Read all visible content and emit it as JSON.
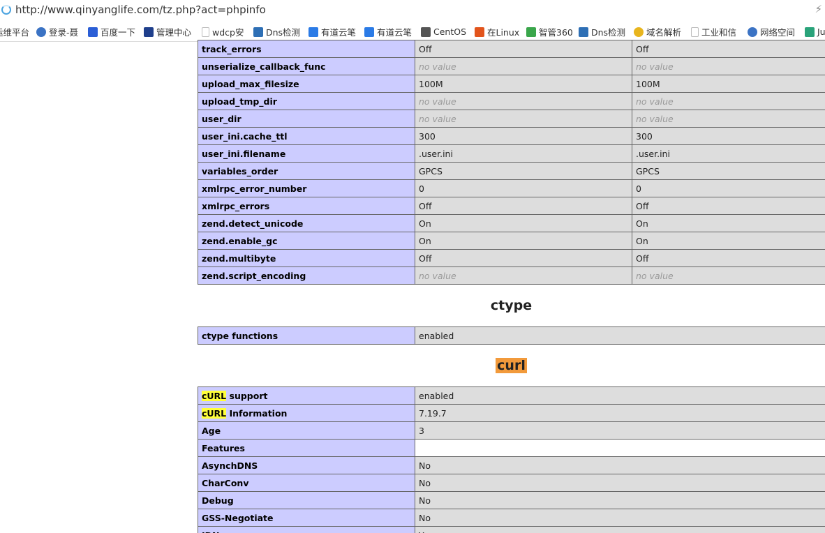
{
  "address_bar": {
    "url": "http://www.qinyanglife.com/tz.php?act=phpinfo"
  },
  "bookmarks": [
    {
      "label": "运维平台",
      "icon": "none",
      "color": "#ffffff"
    },
    {
      "label": "登录-聂",
      "icon": "globe-icon",
      "color": "#3b73c4"
    },
    {
      "label": "百度一下",
      "icon": "paw-icon",
      "color": "#2b5ed6"
    },
    {
      "label": "管理中心",
      "icon": "idc-icon",
      "color": "#1f3f8c"
    },
    {
      "label": "wdcp安",
      "icon": "page-icon",
      "color": "#bbbbbb"
    },
    {
      "label": "Dns检测",
      "icon": "chart-icon",
      "color": "#2e6fb5"
    },
    {
      "label": "有道云笔",
      "icon": "note-icon",
      "color": "#2b7be6"
    },
    {
      "label": "有道云笔",
      "icon": "note-icon",
      "color": "#2b7be6"
    },
    {
      "label": "CentOS",
      "icon": "centos-icon",
      "color": "#555555"
    },
    {
      "label": "在Linux",
      "icon": "bracket-icon",
      "color": "#e2541c"
    },
    {
      "label": "智管360",
      "icon": "g-icon",
      "color": "#3aa64b"
    },
    {
      "label": "Dns检测",
      "icon": "chart-icon",
      "color": "#2e6fb5"
    },
    {
      "label": "域名解析",
      "icon": "ball-icon",
      "color": "#e8b51e"
    },
    {
      "label": "工业和信",
      "icon": "page-icon",
      "color": "#bbbbbb"
    },
    {
      "label": "网络空间",
      "icon": "globe-icon",
      "color": "#3b73c4"
    },
    {
      "label": "Ju",
      "icon": "stack-icon",
      "color": "#2aa37a"
    }
  ],
  "config_rows": [
    {
      "name": "track_errors",
      "local": "Off",
      "master": "Off",
      "nv": false
    },
    {
      "name": "unserialize_callback_func",
      "local": "no value",
      "master": "no value",
      "nv": true
    },
    {
      "name": "upload_max_filesize",
      "local": "100M",
      "master": "100M",
      "nv": false
    },
    {
      "name": "upload_tmp_dir",
      "local": "no value",
      "master": "no value",
      "nv": true
    },
    {
      "name": "user_dir",
      "local": "no value",
      "master": "no value",
      "nv": true
    },
    {
      "name": "user_ini.cache_ttl",
      "local": "300",
      "master": "300",
      "nv": false
    },
    {
      "name": "user_ini.filename",
      "local": ".user.ini",
      "master": ".user.ini",
      "nv": false
    },
    {
      "name": "variables_order",
      "local": "GPCS",
      "master": "GPCS",
      "nv": false
    },
    {
      "name": "xmlrpc_error_number",
      "local": "0",
      "master": "0",
      "nv": false
    },
    {
      "name": "xmlrpc_errors",
      "local": "Off",
      "master": "Off",
      "nv": false
    },
    {
      "name": "zend.detect_unicode",
      "local": "On",
      "master": "On",
      "nv": false
    },
    {
      "name": "zend.enable_gc",
      "local": "On",
      "master": "On",
      "nv": false
    },
    {
      "name": "zend.multibyte",
      "local": "Off",
      "master": "Off",
      "nv": false
    },
    {
      "name": "zend.script_encoding",
      "local": "no value",
      "master": "no value",
      "nv": true
    }
  ],
  "ctype": {
    "heading": "ctype",
    "rows": [
      {
        "name": "ctype functions",
        "value": "enabled"
      }
    ]
  },
  "curl": {
    "heading": "curl",
    "rows": [
      {
        "hl": "cURL",
        "name": " support",
        "value": "enabled"
      },
      {
        "hl": "cURL",
        "name": " Information",
        "value": "7.19.7"
      },
      {
        "hl": "",
        "name": "Age",
        "value": "3"
      },
      {
        "hl": "",
        "name": "Features",
        "value": ""
      },
      {
        "hl": "",
        "name": "AsynchDNS",
        "value": "No"
      },
      {
        "hl": "",
        "name": "CharConv",
        "value": "No"
      },
      {
        "hl": "",
        "name": "Debug",
        "value": "No"
      },
      {
        "hl": "",
        "name": "GSS-Negotiate",
        "value": "No"
      },
      {
        "hl": "",
        "name": "IDN",
        "value": "Yes"
      }
    ]
  }
}
